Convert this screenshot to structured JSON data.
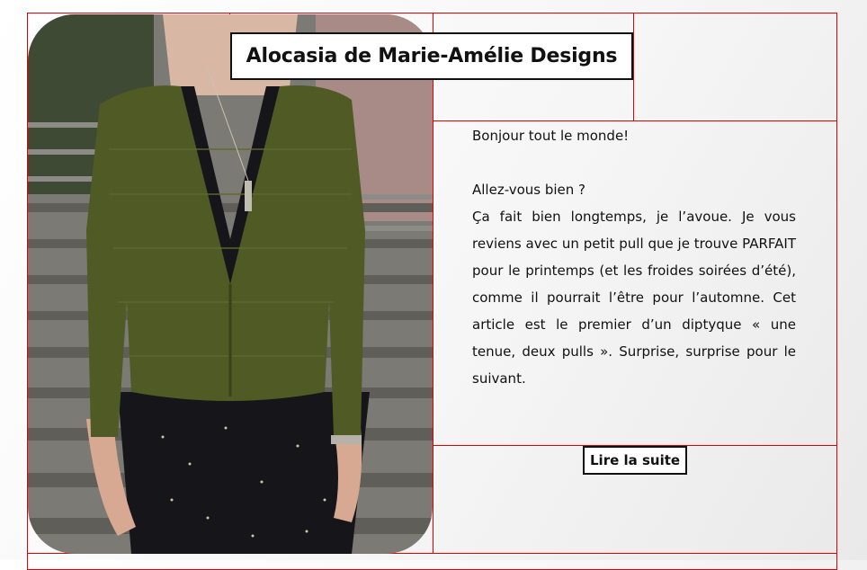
{
  "article": {
    "title": "Alocasia de Marie-Amélie Designs",
    "image_alt": "Pull vert tricoté porté sur une robe noire",
    "paragraphs": {
      "greeting": "Bonjour tout le monde!",
      "question": "Allez-vous bien ?",
      "body": "Ça fait bien longtemps, je l’avoue. Je vous reviens avec un petit pull que je trouve PARFAIT pour le printemps (et les froides soirées d’été), comme il pourrait l’être pour l’automne. Cet article est le premier d’un diptyque « une tenue, deux pulls ». Surprise, surprise pour le suivant."
    },
    "read_more_label": "Lire la suite"
  },
  "colors": {
    "outline": "#e00000",
    "text": "#111111",
    "sweater": "#4f5a24",
    "dress": "#15151a"
  }
}
